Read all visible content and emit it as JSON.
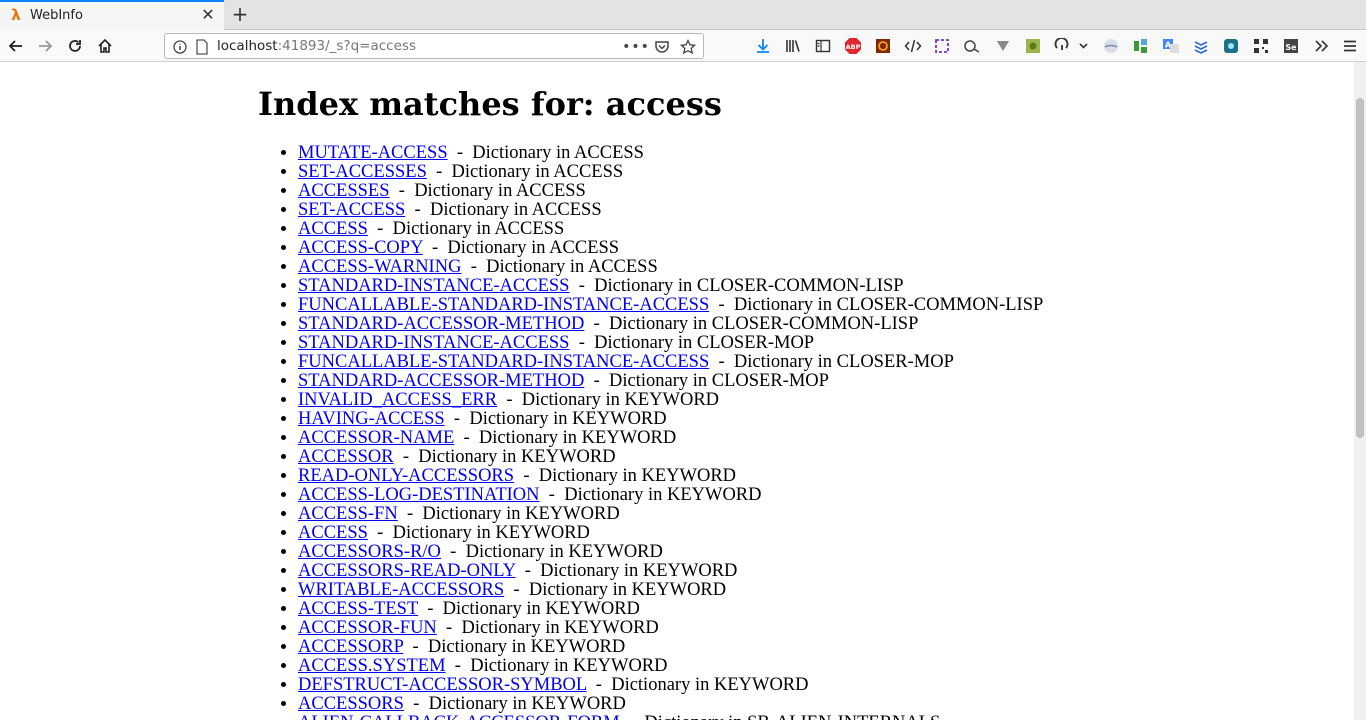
{
  "browser": {
    "tab_title": "WebInfo",
    "url_host": "localhost",
    "url_rest": ":41893/_s?q=access"
  },
  "page": {
    "heading": "Index matches for: access",
    "separator": "  -  ",
    "results": [
      {
        "name": "MUTATE-ACCESS",
        "desc": "Dictionary in ACCESS"
      },
      {
        "name": "SET-ACCESSES",
        "desc": "Dictionary in ACCESS"
      },
      {
        "name": "ACCESSES",
        "desc": "Dictionary in ACCESS"
      },
      {
        "name": "SET-ACCESS",
        "desc": "Dictionary in ACCESS"
      },
      {
        "name": "ACCESS",
        "desc": "Dictionary in ACCESS"
      },
      {
        "name": "ACCESS-COPY",
        "desc": "Dictionary in ACCESS"
      },
      {
        "name": "ACCESS-WARNING",
        "desc": "Dictionary in ACCESS"
      },
      {
        "name": "STANDARD-INSTANCE-ACCESS",
        "desc": "Dictionary in CLOSER-COMMON-LISP"
      },
      {
        "name": "FUNCALLABLE-STANDARD-INSTANCE-ACCESS",
        "desc": "Dictionary in CLOSER-COMMON-LISP"
      },
      {
        "name": "STANDARD-ACCESSOR-METHOD",
        "desc": "Dictionary in CLOSER-COMMON-LISP"
      },
      {
        "name": "STANDARD-INSTANCE-ACCESS",
        "desc": "Dictionary in CLOSER-MOP"
      },
      {
        "name": "FUNCALLABLE-STANDARD-INSTANCE-ACCESS",
        "desc": "Dictionary in CLOSER-MOP"
      },
      {
        "name": "STANDARD-ACCESSOR-METHOD",
        "desc": "Dictionary in CLOSER-MOP"
      },
      {
        "name": "INVALID_ACCESS_ERR",
        "desc": "Dictionary in KEYWORD"
      },
      {
        "name": "HAVING-ACCESS",
        "desc": "Dictionary in KEYWORD"
      },
      {
        "name": "ACCESSOR-NAME",
        "desc": "Dictionary in KEYWORD"
      },
      {
        "name": "ACCESSOR",
        "desc": "Dictionary in KEYWORD"
      },
      {
        "name": "READ-ONLY-ACCESSORS",
        "desc": "Dictionary in KEYWORD"
      },
      {
        "name": "ACCESS-LOG-DESTINATION",
        "desc": "Dictionary in KEYWORD"
      },
      {
        "name": "ACCESS-FN",
        "desc": "Dictionary in KEYWORD"
      },
      {
        "name": "ACCESS",
        "desc": "Dictionary in KEYWORD"
      },
      {
        "name": "ACCESSORS-R/O",
        "desc": "Dictionary in KEYWORD"
      },
      {
        "name": "ACCESSORS-READ-ONLY",
        "desc": "Dictionary in KEYWORD"
      },
      {
        "name": "WRITABLE-ACCESSORS",
        "desc": "Dictionary in KEYWORD"
      },
      {
        "name": "ACCESS-TEST",
        "desc": "Dictionary in KEYWORD"
      },
      {
        "name": "ACCESSOR-FUN",
        "desc": "Dictionary in KEYWORD"
      },
      {
        "name": "ACCESSORP",
        "desc": "Dictionary in KEYWORD"
      },
      {
        "name": "ACCESS.SYSTEM",
        "desc": "Dictionary in KEYWORD"
      },
      {
        "name": "DEFSTRUCT-ACCESSOR-SYMBOL",
        "desc": "Dictionary in KEYWORD"
      },
      {
        "name": "ACCESSORS",
        "desc": "Dictionary in KEYWORD"
      },
      {
        "name": "ALIEN-CALLBACK-ACCESSOR-FORM",
        "desc": "Dictionary in SB-ALIEN-INTERNALS"
      }
    ]
  },
  "colors": {
    "link": "#0000ee",
    "tab_accent": "#0a84ff"
  },
  "icons": {
    "tab_favicon": "lambda-icon",
    "toolbar": [
      "download-icon",
      "library-icon",
      "sidebar-icon",
      "adblock-icon",
      "extension-icon",
      "code-icon",
      "screenshot-icon",
      "extension-icon",
      "filter-icon",
      "extension-icon",
      "sync-icon",
      "extension-icon",
      "extension-icon",
      "translate-icon",
      "layers-icon",
      "extension-icon",
      "qr-icon",
      "selenium-icon",
      "overflow-icon",
      "menu-icon"
    ]
  }
}
